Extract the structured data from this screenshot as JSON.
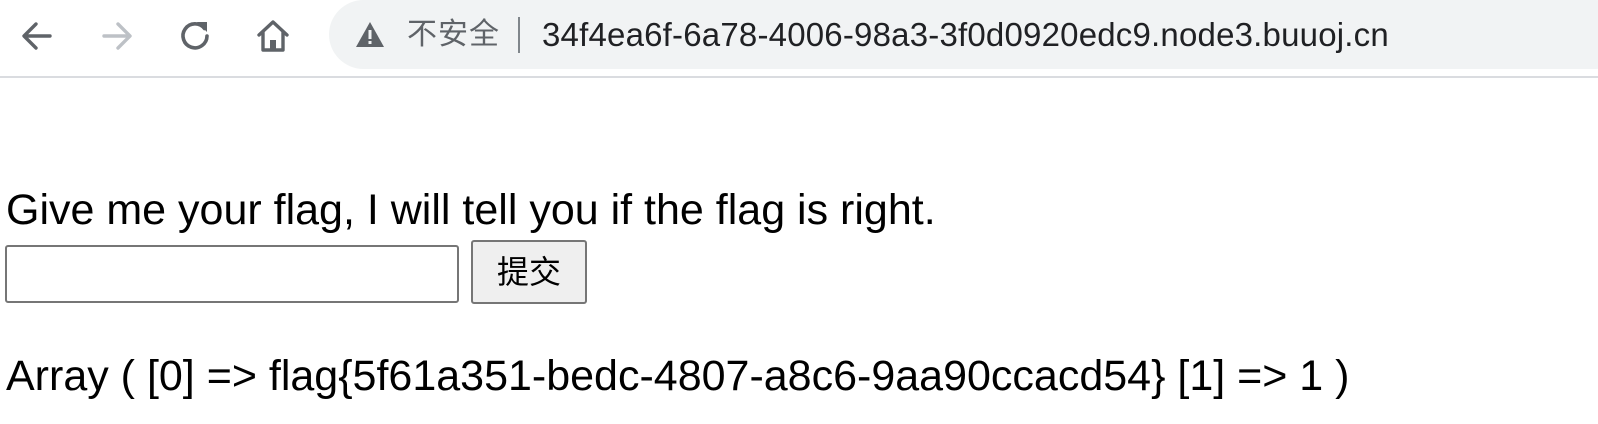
{
  "browser": {
    "icons": {
      "back": "arrow-left-icon",
      "forward": "arrow-right-icon",
      "reload": "reload-icon",
      "home": "home-icon",
      "security": "warning-triangle-icon"
    },
    "forward_disabled": true,
    "security_label": "不安全",
    "url": "34f4ea6f-6a78-4006-98a3-3f0d0920edc9.node3.buuoj.cn",
    "colors": {
      "icon_active": "#5f6368",
      "icon_disabled": "#bdc1c6",
      "omnibox_bg": "#f1f3f4"
    }
  },
  "page": {
    "prompt": "Give me your flag, I will tell you if the flag is right.",
    "form": {
      "input_value": "",
      "submit_label": "提交"
    },
    "result": "Array ( [0] => flag{5f61a351-bedc-4807-a8c6-9aa90ccacd54} [1] => 1 )"
  }
}
